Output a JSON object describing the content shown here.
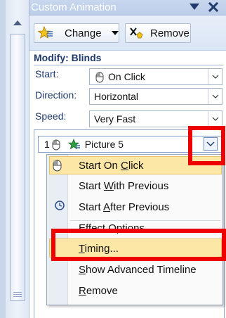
{
  "pane": {
    "title": "Custom Animation",
    "change_label": "Change",
    "remove_label": "Remove",
    "section_title": "Modify: Blinds"
  },
  "fields": {
    "start_label": "Start:",
    "start_value": "On Click",
    "direction_label": "Direction:",
    "direction_value": "Horizontal",
    "speed_label": "Speed:",
    "speed_value": "Very Fast"
  },
  "list": {
    "item_number": "1",
    "item_name": "Picture 5"
  },
  "context_menu": {
    "items": [
      {
        "pre": "Start On ",
        "key": "C",
        "post": "lick"
      },
      {
        "pre": "Start ",
        "key": "W",
        "post": "ith Previous"
      },
      {
        "pre": "Start ",
        "key": "A",
        "post": "fter Previous"
      },
      {
        "pre": "",
        "key": "E",
        "post": "ffect Options..."
      },
      {
        "pre": "",
        "key": "T",
        "post": "iming..."
      },
      {
        "pre": "",
        "key": "S",
        "post": "how Advanced Timeline"
      },
      {
        "pre": "",
        "key": "R",
        "post": "emove"
      }
    ]
  },
  "colors": {
    "highlight": "#fde7a6",
    "annotation_red": "#ee0000",
    "section_text": "#1f3a6b"
  },
  "icons": [
    "star-change-icon",
    "remove-x-icon",
    "mouse-click-icon",
    "clock-icon",
    "chevron-down-icon",
    "close-icon"
  ]
}
